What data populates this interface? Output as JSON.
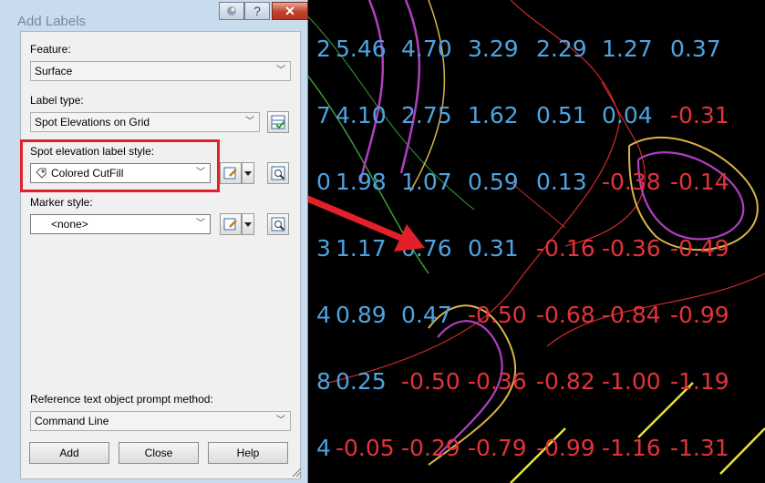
{
  "dialog": {
    "title": "Add Labels",
    "titlebar_buttons": {
      "help": "?",
      "close": "✕"
    },
    "feature": {
      "label": "Feature:",
      "value": "Surface"
    },
    "label_type": {
      "label": "Label type:",
      "value": "Spot Elevations on Grid"
    },
    "spot_style": {
      "label": "Spot elevation label style:",
      "value": "Colored CutFill"
    },
    "marker_style": {
      "label": "Marker style:",
      "value": "<none>"
    },
    "reference": {
      "label": "Reference text object prompt method:",
      "value": "Command Line"
    },
    "buttons": {
      "add": "Add",
      "close": "Close",
      "help": "Help"
    }
  },
  "background": {
    "rows": [
      [
        "2",
        "5.46",
        "4.70",
        "3.29",
        "2.29",
        "1.27",
        "0.37"
      ],
      [
        "7",
        "4.10",
        "2.75",
        "1.62",
        "0.51",
        "0.04",
        "-0.31"
      ],
      [
        "0",
        "1.98",
        "1.07",
        "0.59",
        "0.13",
        "-0.38",
        "-0.14"
      ],
      [
        "3",
        "1.17",
        "0.76",
        "0.31",
        "-0.16",
        "-0.36",
        "-0.49"
      ],
      [
        "4",
        "0.89",
        "0.47",
        "-0.50",
        "-0.68",
        "-0.84",
        "-0.99"
      ],
      [
        "8",
        "0.25",
        "-0.50",
        "-0.36",
        "-0.82",
        "-1.00",
        "-1.19"
      ],
      [
        "4",
        "-0.05",
        "-0.29",
        "-0.79",
        "-0.99",
        "-1.16",
        "-1.31"
      ]
    ],
    "fill_color": "#4ea3e0",
    "cut_color": "#e2333b"
  }
}
